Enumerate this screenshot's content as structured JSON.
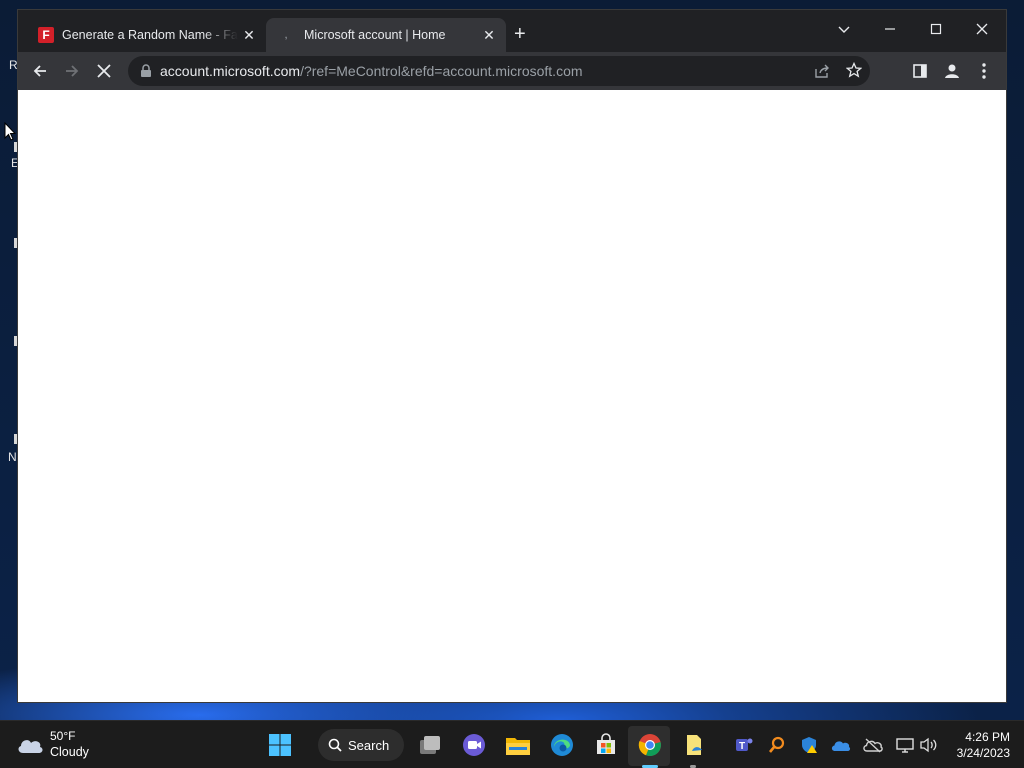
{
  "desktop": {
    "labels": [
      "R",
      "E",
      "N"
    ]
  },
  "browser": {
    "tabs": [
      {
        "title": "Generate a Random Name - Fake",
        "favicon": "F",
        "active": false
      },
      {
        "title": "Microsoft account | Home",
        "favicon": ",",
        "active": true
      }
    ],
    "new_tab_label": "+",
    "address": {
      "host": "account.microsoft.com",
      "path": "/?ref=MeControl&refd=account.microsoft.com"
    },
    "loading": true,
    "accent": "#35363a"
  },
  "taskbar": {
    "weather": {
      "temperature": "50°F",
      "condition": "Cloudy",
      "icon": "cloud-icon"
    },
    "search_label": "Search",
    "pinned": [
      "start-icon",
      "task-view-icon",
      "chat-icon",
      "file-explorer-icon",
      "edge-icon",
      "store-icon",
      "chrome-icon",
      "notepad-icon"
    ],
    "tray": [
      "teams-icon",
      "search-tool-icon",
      "defender-icon",
      "onedrive-icon",
      "cloud-offline-icon",
      "network-icon",
      "volume-icon"
    ],
    "clock": {
      "time": "4:26 PM",
      "date": "3/24/2023"
    }
  }
}
